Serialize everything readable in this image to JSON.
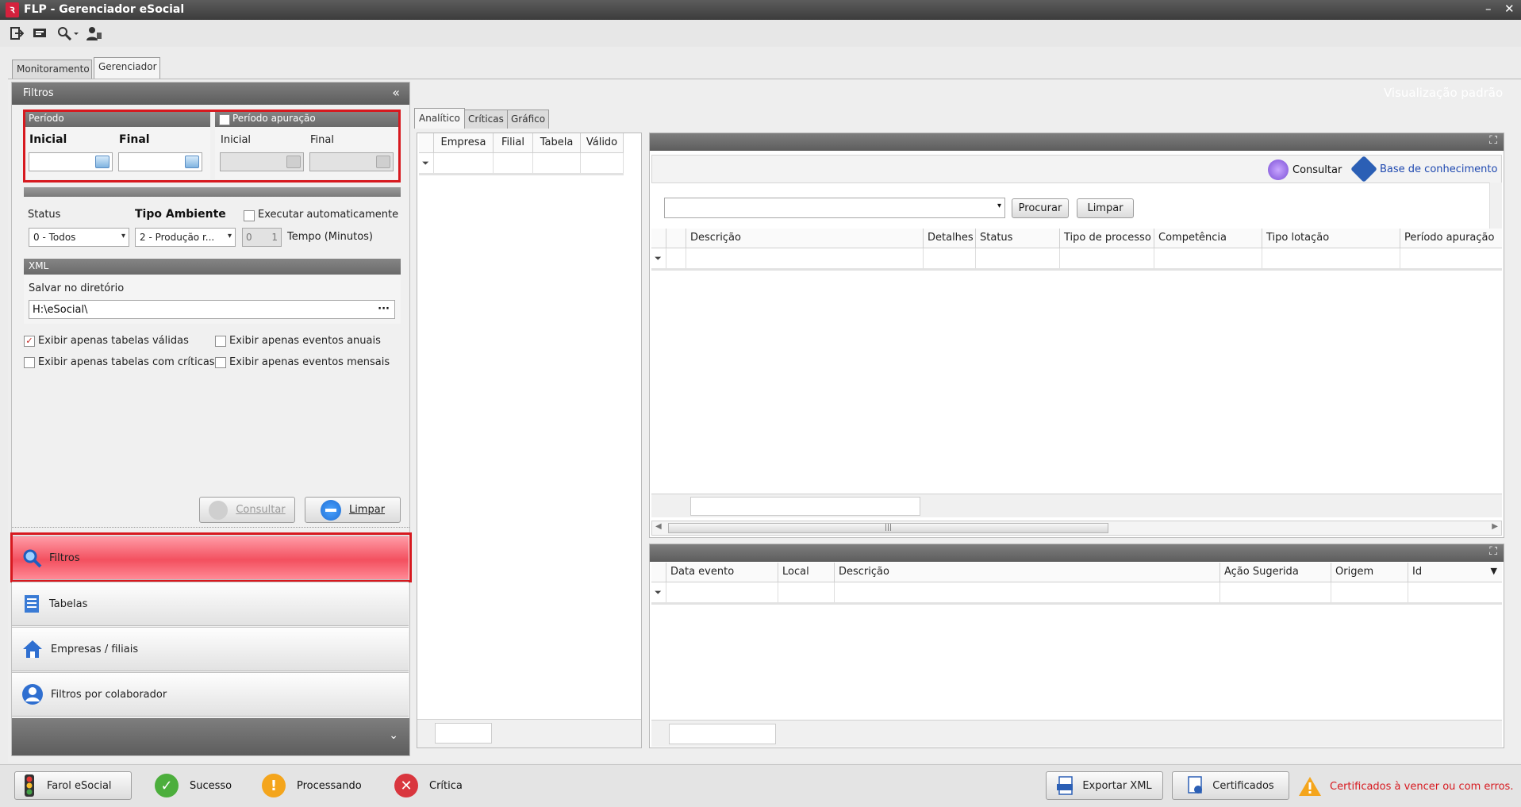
{
  "window": {
    "title": "FLP - Gerenciador eSocial",
    "logo": "FLP logo",
    "minimize": "–",
    "close": "✕"
  },
  "toolbar": {
    "icons": [
      "exit-icon",
      "message-icon",
      "search-icon",
      "user-icon"
    ]
  },
  "tabs": {
    "monitoramento": "Monitoramento",
    "gerenciador": "Gerenciador"
  },
  "filtros_panel": {
    "title": "Filtros",
    "collapse": "«",
    "periodo": {
      "title": "Período",
      "inicial": "Inicial",
      "final": "Final",
      "inicial_value": "",
      "final_value": ""
    },
    "periodo_apuracao": {
      "title": "Período apuração",
      "checked": false,
      "inicial": "Inicial",
      "final": "Final"
    },
    "status": {
      "label": "Status",
      "value": "0 - Todos"
    },
    "tipo_ambiente": {
      "label": "Tipo Ambiente",
      "value": "2 - Produção r..."
    },
    "executar": {
      "label": "Executar automaticamente",
      "checked": false
    },
    "tempo": {
      "value": "0",
      "spin": "1",
      "label": "Tempo (Minutos)"
    },
    "xml": {
      "title": "XML",
      "salvar_label": "Salvar no diretório",
      "salvar_value": "H:\\eSocial\\",
      "browse": "···"
    },
    "checks": [
      {
        "label": "Exibir apenas tabelas válidas",
        "checked": true
      },
      {
        "label": "Exibir apenas eventos anuais",
        "checked": false
      },
      {
        "label": "Exibir apenas tabelas com críticas",
        "checked": false
      },
      {
        "label": "Exibir apenas eventos mensais",
        "checked": false
      }
    ],
    "consultar": "Consultar",
    "limpar": "Limpar"
  },
  "nav": {
    "items": [
      "Filtros",
      "Tabelas",
      "Empresas / filiais",
      "Filtros por colaborador"
    ],
    "expand": "⌄"
  },
  "view_label": "Visualização padrão",
  "center_tabs": [
    "Analítico",
    "Críticas",
    "Gráfico"
  ],
  "left_grid": {
    "columns": [
      "Empresa",
      "Filial",
      "Tabela",
      "Válido"
    ]
  },
  "right_top": {
    "consultar": "Consultar",
    "base_conhecimento": "Base de conhecimento",
    "search_value": "",
    "procurar": "Procurar",
    "limpar": "Limpar",
    "columns": [
      "Descrição",
      "Detalhes",
      "Status",
      "Tipo de processo",
      "Competência",
      "Tipo lotação",
      "Período apuração"
    ]
  },
  "right_bottom": {
    "columns": [
      "Data evento",
      "Local",
      "Descrição",
      "Ação Sugerida",
      "Origem",
      "Id"
    ]
  },
  "status_bar": {
    "farol": "Farol eSocial",
    "sucesso": "Sucesso",
    "processando": "Processando",
    "critica": "Crítica",
    "exportar": "Exportar XML",
    "certificados": "Certificados",
    "alerta": "Certificados à vencer ou com erros.",
    "colors": {
      "sucesso": "#4cae3c",
      "processando": "#f4a51c",
      "critica": "#d9363e",
      "alerta": "#d7191f"
    }
  }
}
